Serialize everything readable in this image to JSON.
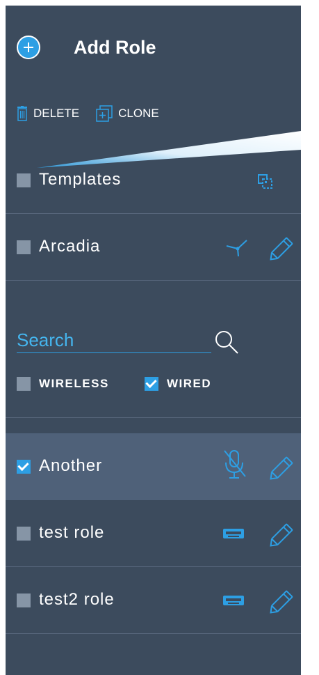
{
  "header": {
    "add_role_label": "Add Role"
  },
  "actions": {
    "delete_label": "DELETE",
    "clone_label": "CLONE"
  },
  "top_items": [
    {
      "label": "Templates",
      "checked": false,
      "icon": "copy-icon"
    },
    {
      "label": "Arcadia",
      "checked": false,
      "icon": "network-node-icon"
    }
  ],
  "search": {
    "placeholder": "Search",
    "value": ""
  },
  "filters": [
    {
      "label": "WIRELESS",
      "checked": false
    },
    {
      "label": "WIRED",
      "checked": true
    }
  ],
  "roles": [
    {
      "label": "Another",
      "checked": true,
      "selected": true,
      "icon": "microphone-muted-icon"
    },
    {
      "label": "test role",
      "checked": false,
      "selected": false,
      "icon": "ethernet-port-icon"
    },
    {
      "label": "test2 role",
      "checked": false,
      "selected": false,
      "icon": "ethernet-port-icon"
    }
  ],
  "colors": {
    "panel_bg": "#3c4b5d",
    "accent": "#2d9fe4",
    "selected_row_bg": "#4f6179",
    "checkbox_unchecked": "#8695a6"
  }
}
